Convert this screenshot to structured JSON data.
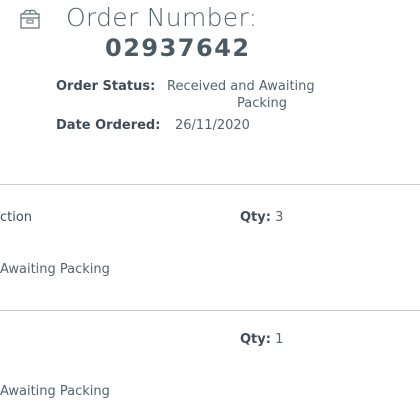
{
  "order": {
    "heading": "Order Number:",
    "number": "02937642",
    "status_label": "Order Status:",
    "status_value_line1": "Received and Awaiting",
    "status_value_line2": "Packing",
    "date_label": "Date Ordered:",
    "date_value": "26/11/2020",
    "icon": "package-box-icon"
  },
  "items": [
    {
      "name": "ction",
      "qty_label": "Qty:",
      "qty_value": "3",
      "status": "Awaiting Packing"
    },
    {
      "name": "",
      "qty_label": "Qty:",
      "qty_value": "1",
      "status": "Awaiting Packing"
    }
  ],
  "colors": {
    "heading": "#546068",
    "label": "#3e4d58",
    "value": "#55636c",
    "divider": "#c9cdd0"
  }
}
